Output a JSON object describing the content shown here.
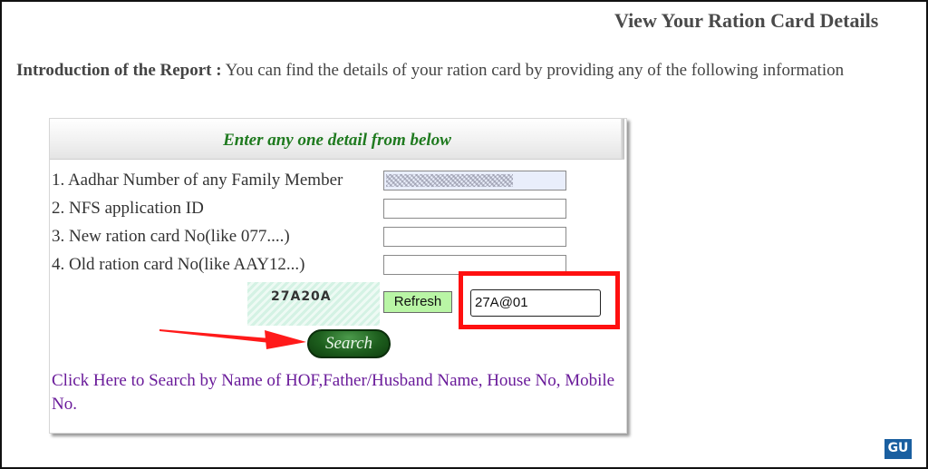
{
  "page": {
    "title": "View Your Ration Card Details",
    "intro_label": "Introduction of the Report :",
    "intro_text": " You can find the details of your ration card by providing any of the following information"
  },
  "panel": {
    "heading": "Enter any one detail from below",
    "fields": [
      {
        "label": "1. Aadhar Number of any Family Member",
        "value": ""
      },
      {
        "label": "2. NFS application ID",
        "value": ""
      },
      {
        "label": "3. New ration card No(like 077....)",
        "value": ""
      },
      {
        "label": "4. Old ration card No(like AAY12...)",
        "value": ""
      }
    ],
    "captcha_text": "27A20A",
    "refresh_label": "Refresh",
    "captcha_input_value": "27A@01",
    "search_label": "Search",
    "hof_link_text": "Click Here to Search by Name of HOF,Father/Husband Name, House No, Mobile No."
  },
  "watermark": {
    "text": "GU"
  },
  "colors": {
    "heading_green": "#1f7a1f",
    "link_purple": "#6a1b9a",
    "highlight_red": "#ff1010",
    "refresh_green": "#b9f5a5"
  }
}
